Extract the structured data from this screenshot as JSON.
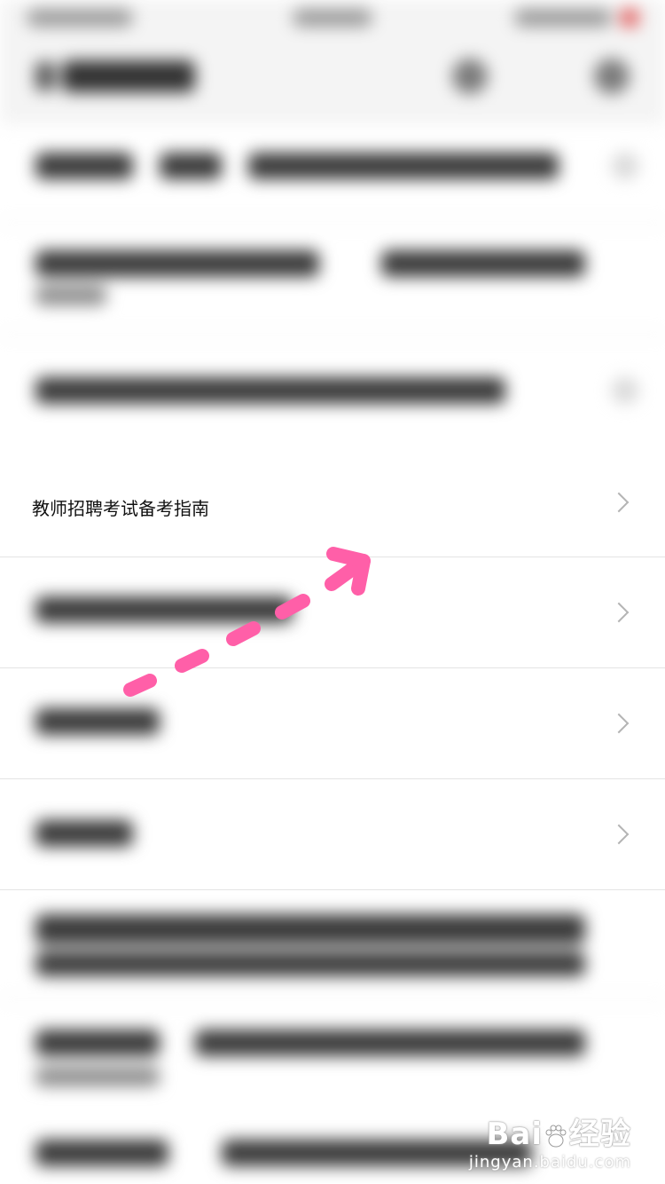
{
  "highlighted_item": {
    "label": "教师招聘考试备考指南"
  },
  "annotation": {
    "arrow_color": "#ff5fa8"
  },
  "watermark": {
    "brand": "Bai",
    "brand_cn": "经验",
    "site": "jingyan.baidu.com"
  },
  "icons": [
    "chevron-right-icon",
    "arrow-annotation-icon",
    "baidu-paw-logo"
  ]
}
